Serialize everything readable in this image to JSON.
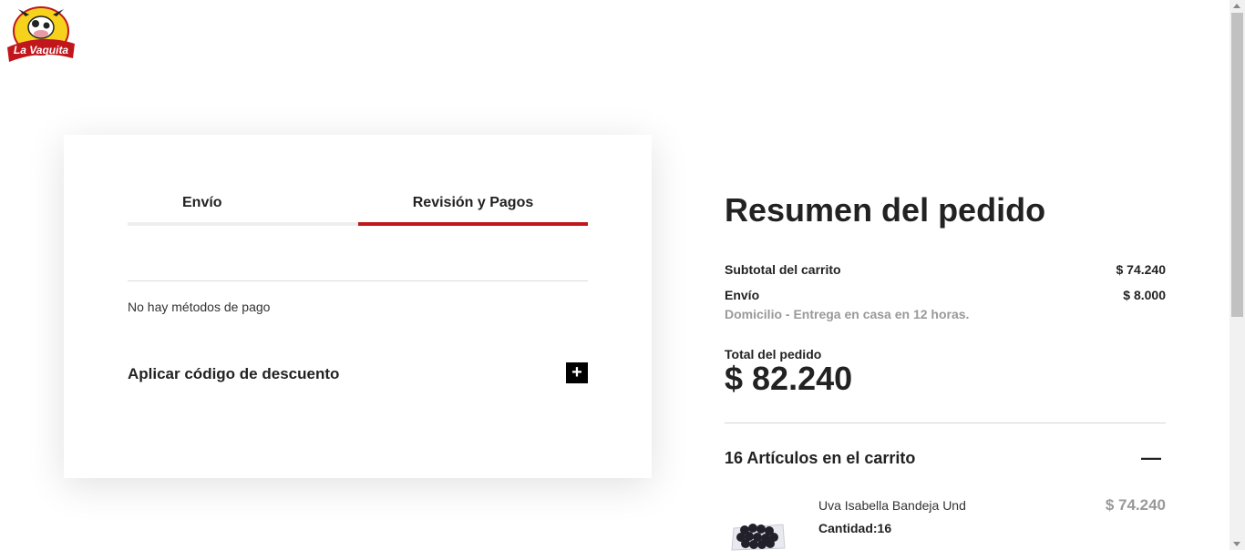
{
  "brand": {
    "logo_text": "La Vaquita",
    "accent_color": "#c0161c"
  },
  "checkout": {
    "tabs": [
      {
        "label": "Envío",
        "active": false
      },
      {
        "label": "Revisión y Pagos",
        "active": true
      }
    ],
    "no_payment_methods": "No hay métodos de pago",
    "discount_label": "Aplicar código de descuento",
    "discount_toggle_icon": "plus-icon",
    "discount_toggle_glyph": "+"
  },
  "summary": {
    "title": "Resumen del pedido",
    "subtotal_label": "Subtotal del carrito",
    "subtotal_value": "$ 74.240",
    "shipping_label": "Envío",
    "shipping_value": "$ 8.000",
    "shipping_description": "Domicilio - Entrega en casa en 12 horas.",
    "total_label": "Total del pedido",
    "total_value": "$ 82.240",
    "items_count_label": "16 Artículos en el carrito",
    "collapse_icon": "minus-icon",
    "collapse_glyph": "—",
    "items": [
      {
        "name": "Uva Isabella Bandeja Und",
        "quantity_label": "Cantidad:16",
        "price": "$ 74.240"
      }
    ]
  }
}
